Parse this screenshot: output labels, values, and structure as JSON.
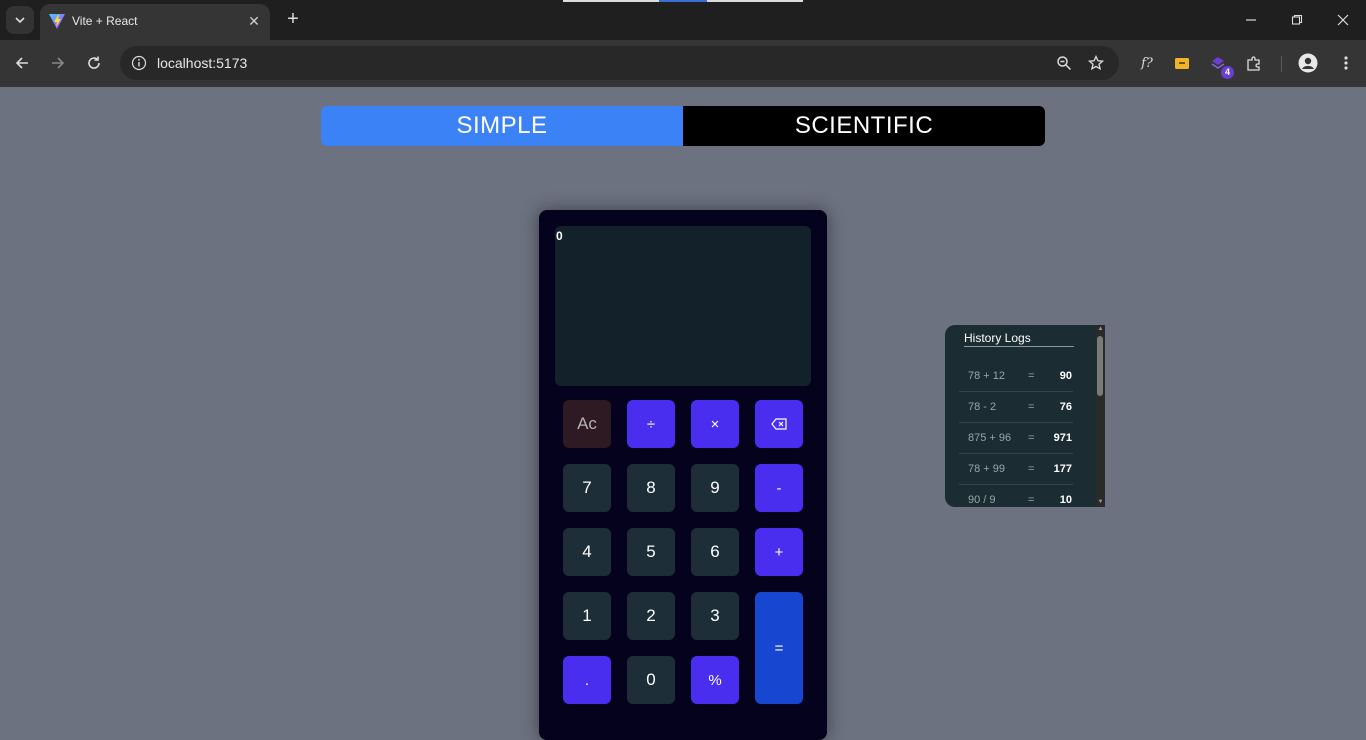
{
  "browser": {
    "tab_title": "Vite + React",
    "new_tab_label": "+",
    "url": "localhost:5173",
    "extensions_badge": "4",
    "font_ext_label": "f?"
  },
  "mode_switch": {
    "simple_label": "SIMPLE",
    "scientific_label": "SCIENTIFIC",
    "active": "SIMPLE"
  },
  "calculator": {
    "display_value": "0",
    "keys": {
      "ac": "Ac",
      "divide": "÷",
      "multiply": "×",
      "n7": "7",
      "n8": "8",
      "n9": "9",
      "minus": "-",
      "n4": "4",
      "n5": "5",
      "n6": "6",
      "plus": "+",
      "n1": "1",
      "n2": "2",
      "n3": "3",
      "equals": "=",
      "dot": ".",
      "n0": "0",
      "percent": "%"
    }
  },
  "history": {
    "title": "History Logs",
    "entries": [
      {
        "expr": "78 + 12",
        "eq": "=",
        "result": "90"
      },
      {
        "expr": "78 - 2",
        "eq": "=",
        "result": "76"
      },
      {
        "expr": "875 + 96",
        "eq": "=",
        "result": "971"
      },
      {
        "expr": "78 + 99",
        "eq": "=",
        "result": "177"
      },
      {
        "expr": "90 / 9",
        "eq": "=",
        "result": "10"
      }
    ]
  },
  "colors": {
    "page_bg": "#6c7280",
    "simple_active": "#3b82f6",
    "scientific": "#000000",
    "operator_key": "#4a2ef0",
    "number_key": "#1e2e38",
    "equals_key": "#1747d0"
  }
}
